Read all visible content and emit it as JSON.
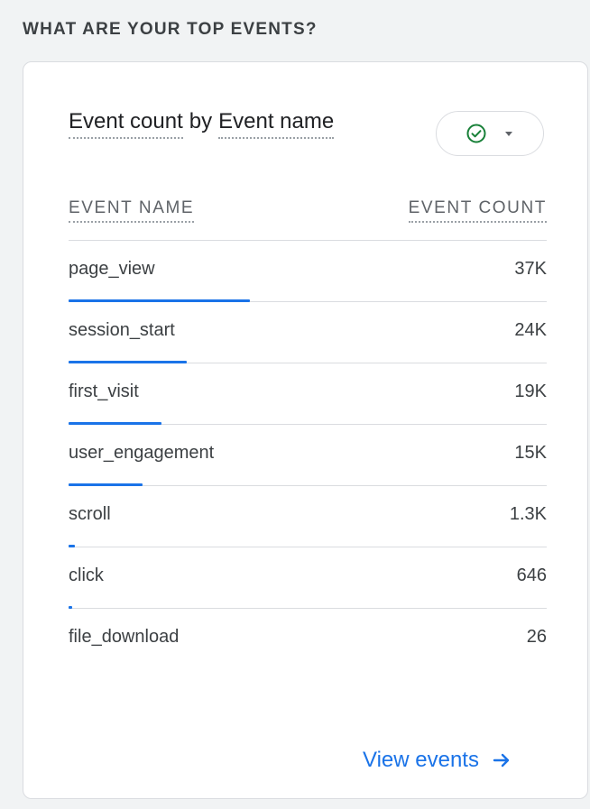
{
  "section": {
    "heading": "WHAT ARE YOUR TOP EVENTS?"
  },
  "card": {
    "title_metric": "Event count",
    "title_by": "by",
    "title_dimension": "Event name",
    "status_icon": "check-circle-icon",
    "dropdown_icon": "caret-down-icon"
  },
  "table": {
    "col_name": "EVENT NAME",
    "col_count": "EVENT COUNT",
    "rows": [
      {
        "name": "page_view",
        "count": "37K",
        "value": 37000
      },
      {
        "name": "session_start",
        "count": "24K",
        "value": 24000
      },
      {
        "name": "first_visit",
        "count": "19K",
        "value": 19000
      },
      {
        "name": "user_engagement",
        "count": "15K",
        "value": 15000
      },
      {
        "name": "scroll",
        "count": "1.3K",
        "value": 1300
      },
      {
        "name": "click",
        "count": "646",
        "value": 646
      },
      {
        "name": "file_download",
        "count": "26",
        "value": 26
      }
    ]
  },
  "footer": {
    "view_label": "View events",
    "arrow_icon": "arrow-right-icon"
  },
  "colors": {
    "accent": "#1a73e8",
    "check": "#188038"
  }
}
